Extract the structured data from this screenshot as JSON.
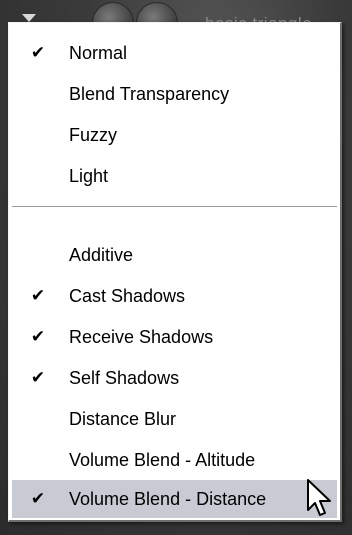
{
  "window": {
    "background_title": "basic triangle"
  },
  "menu": {
    "group1": [
      {
        "label": "Normal",
        "checked": true
      },
      {
        "label": "Blend Transparency",
        "checked": false
      },
      {
        "label": "Fuzzy",
        "checked": false
      },
      {
        "label": "Light",
        "checked": false
      }
    ],
    "group2": [
      {
        "label": "Additive",
        "checked": false
      },
      {
        "label": "Cast Shadows",
        "checked": true
      },
      {
        "label": "Receive Shadows",
        "checked": true
      },
      {
        "label": "Self Shadows",
        "checked": true
      },
      {
        "label": "Distance Blur",
        "checked": false
      },
      {
        "label": "Volume Blend - Altitude",
        "checked": false
      },
      {
        "label": "Volume Blend - Distance",
        "checked": true,
        "highlighted": true
      }
    ],
    "check_glyph": "✔",
    "highlight_color": "#c8cbd4"
  },
  "cursor": {
    "icon": "arrow-pointer-icon"
  }
}
